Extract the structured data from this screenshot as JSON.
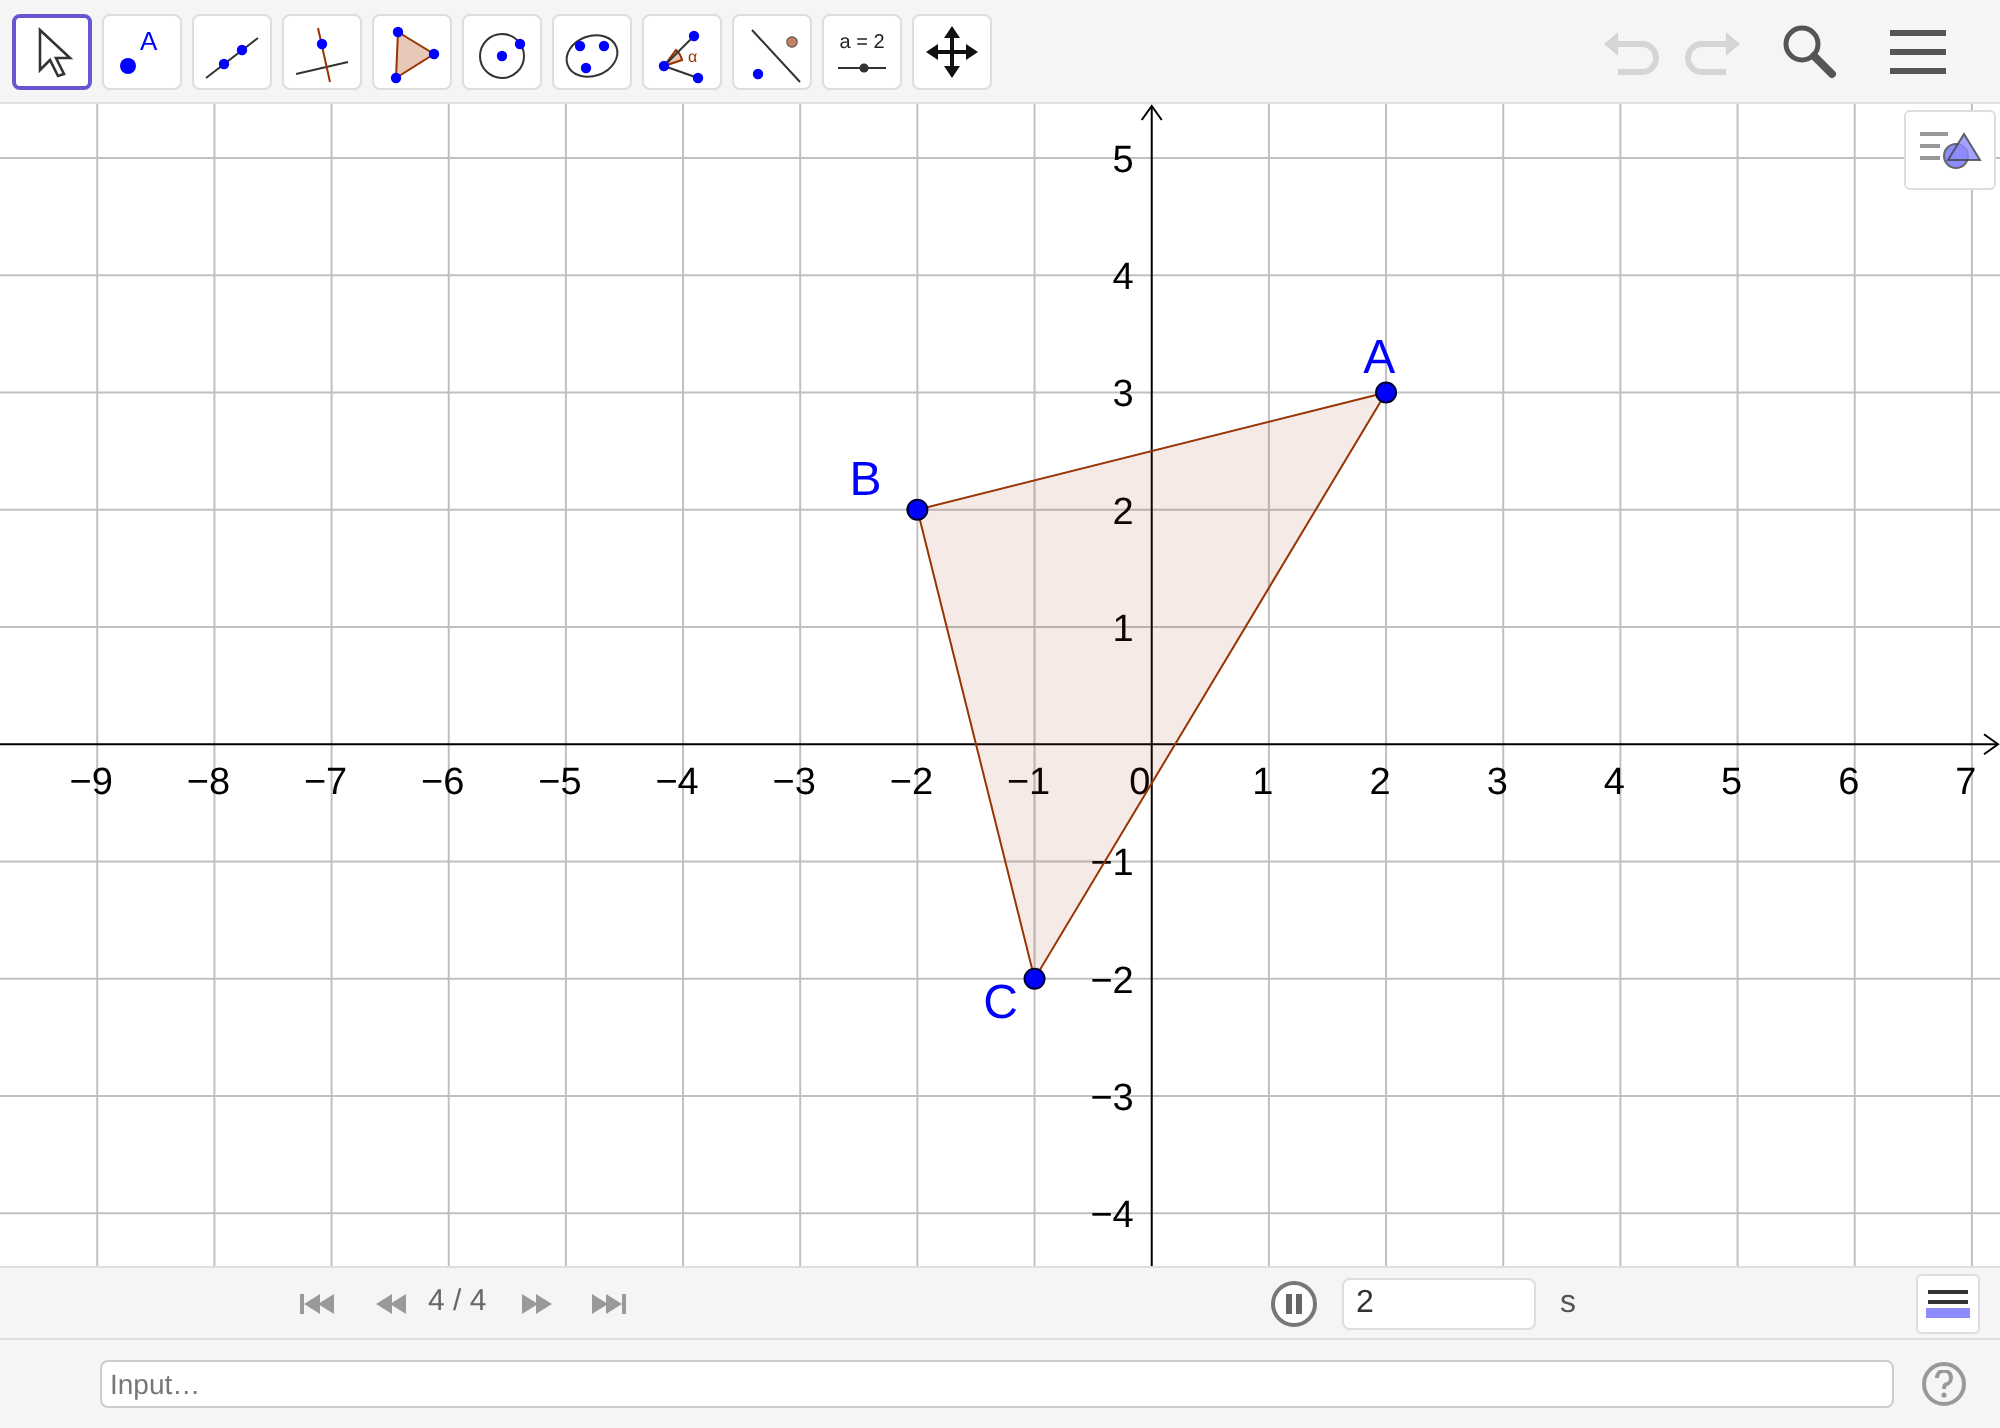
{
  "toolbar": {
    "tools": [
      {
        "kind": "move",
        "selected": true
      },
      {
        "kind": "point",
        "label": "A",
        "selected": false
      },
      {
        "kind": "line",
        "selected": false
      },
      {
        "kind": "perpendicular",
        "selected": false
      },
      {
        "kind": "polygon",
        "selected": false
      },
      {
        "kind": "circle",
        "selected": false
      },
      {
        "kind": "conic",
        "selected": false
      },
      {
        "kind": "angle",
        "label": "α",
        "selected": false
      },
      {
        "kind": "reflect",
        "selected": false
      },
      {
        "kind": "slider",
        "label": "a = 2",
        "selected": false
      },
      {
        "kind": "pan",
        "selected": false
      }
    ],
    "undo": {
      "disabled": true
    },
    "redo": {
      "disabled": true
    }
  },
  "graphics": {
    "chart_data": {
      "type": "scatter",
      "xlim": [
        -9.83,
        7.24
      ],
      "ylim": [
        -4.45,
        5.46
      ],
      "xticks": [
        {
          "value": -9,
          "label": "−9"
        },
        {
          "value": -8,
          "label": "−8"
        },
        {
          "value": -7,
          "label": "−7"
        },
        {
          "value": -6,
          "label": "−6"
        },
        {
          "value": -5,
          "label": "−5"
        },
        {
          "value": -4,
          "label": "−4"
        },
        {
          "value": -3,
          "label": "−3"
        },
        {
          "value": -2,
          "label": "−2"
        },
        {
          "value": -1,
          "label": "−1"
        },
        {
          "value": 0,
          "label": "0"
        },
        {
          "value": 1,
          "label": "1"
        },
        {
          "value": 2,
          "label": "2"
        },
        {
          "value": 3,
          "label": "3"
        },
        {
          "value": 4,
          "label": "4"
        },
        {
          "value": 5,
          "label": "5"
        },
        {
          "value": 6,
          "label": "6"
        },
        {
          "value": 7,
          "label": "7"
        }
      ],
      "yticks": [
        {
          "value": -4,
          "label": "−4"
        },
        {
          "value": -3,
          "label": "−3"
        },
        {
          "value": -2,
          "label": "−2"
        },
        {
          "value": -1,
          "label": "−1"
        },
        {
          "value": 1,
          "label": "1"
        },
        {
          "value": 2,
          "label": "2"
        },
        {
          "value": 3,
          "label": "3"
        },
        {
          "value": 4,
          "label": "4"
        },
        {
          "value": 5,
          "label": "5"
        }
      ],
      "x": [
        2,
        -2,
        -1
      ],
      "series": [
        {
          "color": "#0000ff",
          "values": [
            3,
            2,
            -2
          ]
        }
      ],
      "annotations": [
        "A",
        "B",
        "C"
      ],
      "grid": true
    }
  },
  "playback": {
    "counter": "4 / 4",
    "playing": true,
    "speed": "2",
    "unit": "s"
  },
  "input_bar": {
    "placeholder": "Input…"
  }
}
